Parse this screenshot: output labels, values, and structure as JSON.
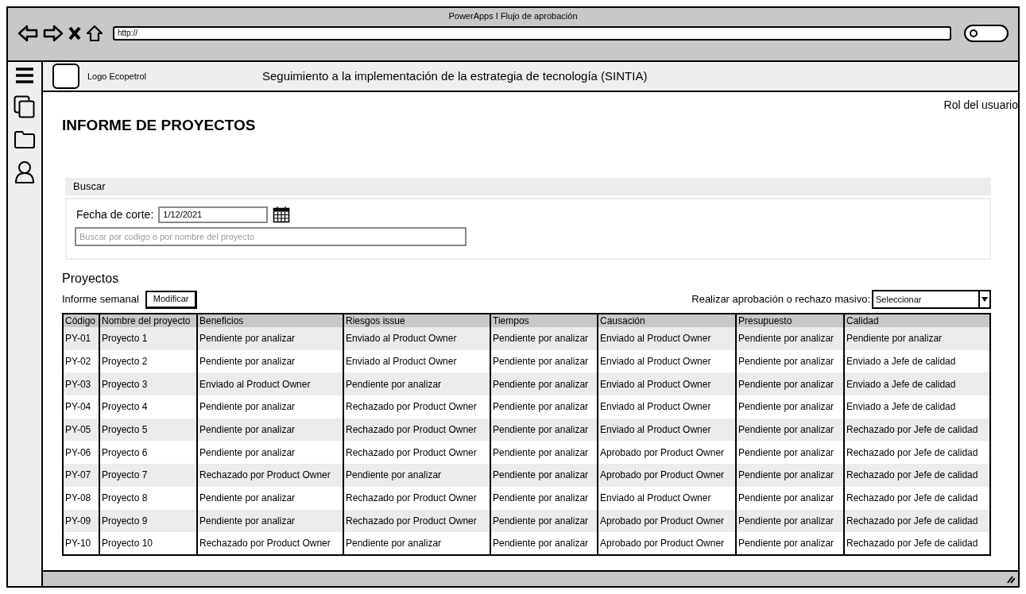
{
  "window": {
    "title": "PowerApps I Flujo de aprobación",
    "url": "http://"
  },
  "header": {
    "logo": "Logo Ecopetrol",
    "title": "Seguimiento a la implementación de la estrategia de tecnología (SINTIA)"
  },
  "user_role": "Rol del usuario",
  "page_title": "INFORME DE PROYECTOS",
  "search": {
    "title": "Buscar",
    "date_label": "Fecha de corte:",
    "date_value": "1/12/2021",
    "placeholder": "Buscar por codigo o por nombre del proyecto"
  },
  "projects": {
    "title": "Proyectos",
    "weekly_label": "Informe semanal",
    "modify_button": "Modificar",
    "bulk_label": "Realizar aprobación o rechazo masivo:",
    "bulk_select": "Seleccionar"
  },
  "table": {
    "columns": [
      "Código",
      "Nombre del proyecto",
      "Beneficios",
      "Riesgos issue",
      "Tiempos",
      "Causación",
      "Presupuesto",
      "Calidad"
    ],
    "rows": [
      [
        "PY-01",
        "Proyecto 1",
        "Pendiente por analizar",
        "Enviado al Product Owner",
        "Pendiente por analizar",
        "Enviado al Product Owner",
        "Pendiente por analizar",
        "Pendiente por analizar"
      ],
      [
        "PY-02",
        "Proyecto 2",
        "Pendiente por analizar",
        "Enviado al Product Owner",
        "Pendiente por analizar",
        "Enviado al Product Owner",
        "Pendiente por analizar",
        "Enviado a Jefe de calidad"
      ],
      [
        "PY-03",
        "Proyecto 3",
        "Enviado al Product Owner",
        "Pendiente por analizar",
        "Pendiente por analizar",
        "Enviado al Product Owner",
        "Pendiente por analizar",
        "Enviado a Jefe de calidad"
      ],
      [
        "PY-04",
        "Proyecto 4",
        "Pendiente por analizar",
        "Rechazado por Product Owner",
        "Pendiente por analizar",
        "Enviado al Product Owner",
        "Pendiente por analizar",
        "Enviado a Jefe de calidad"
      ],
      [
        "PY-05",
        "Proyecto 5",
        "Pendiente por analizar",
        "Rechazado por Product Owner",
        "Pendiente por analizar",
        "Enviado al Product Owner",
        "Pendiente por analizar",
        "Rechazado por Jefe de calidad"
      ],
      [
        "PY-06",
        "Proyecto 6",
        "Pendiente por analizar",
        "Rechazado por Product Owner",
        "Pendiente por analizar",
        "Aprobado por Product Owner",
        "Pendiente por analizar",
        "Rechazado por Jefe de calidad"
      ],
      [
        "PY-07",
        "Proyecto 7",
        "Rechazado por Product Owner",
        "Pendiente por analizar",
        "Pendiente por analizar",
        "Aprobado por Product Owner",
        "Pendiente por analizar",
        "Rechazado por Jefe de calidad"
      ],
      [
        "PY-08",
        "Proyecto 8",
        "Pendiente por analizar",
        "Rechazado por Product Owner",
        "Pendiente por analizar",
        "Enviado al Product Owner",
        "Pendiente por analizar",
        "Rechazado por Jefe de calidad"
      ],
      [
        "PY-09",
        "Proyecto 9",
        "Pendiente por analizar",
        "Rechazado por Product Owner",
        "Pendiente por analizar",
        "Aprobado por Product Owner",
        "Pendiente por analizar",
        "Rechazado por Jefe de calidad"
      ],
      [
        "PY-10",
        "Proyecto 10",
        "Rechazado por Product Owner",
        "Pendiente por analizar",
        "Pendiente por analizar",
        "Aprobado por Product Owner",
        "Pendiente por analizar",
        "Rechazado por Jefe de calidad"
      ]
    ]
  }
}
